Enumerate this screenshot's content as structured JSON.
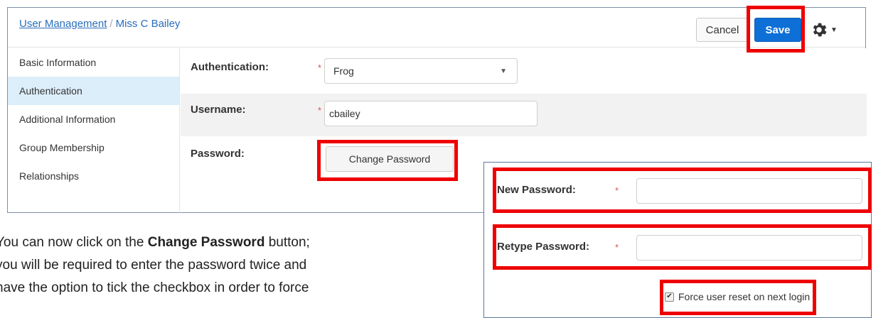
{
  "header": {
    "breadcrumb_root": "User Management",
    "breadcrumb_sep": "/",
    "breadcrumb_current": "Miss C Bailey",
    "cancel_label": "Cancel",
    "save_label": "Save",
    "settings_icon": "gear-icon"
  },
  "sidebar": {
    "items": [
      {
        "label": "Basic Information",
        "active": false
      },
      {
        "label": "Authentication",
        "active": true
      },
      {
        "label": "Additional Information",
        "active": false
      },
      {
        "label": "Group Membership",
        "active": false
      },
      {
        "label": "Relationships",
        "active": false
      }
    ]
  },
  "form": {
    "authentication": {
      "label": "Authentication:",
      "value": "Frog"
    },
    "username": {
      "label": "Username:",
      "value": "cbailey"
    },
    "password": {
      "label": "Password:",
      "button": "Change Password"
    },
    "required_mark": "*"
  },
  "popup": {
    "new_password_label": "New Password:",
    "retype_password_label": "Retype Password:",
    "force_reset_label": "Force user reset on next login",
    "force_reset_checked": true,
    "check_glyph": "✔"
  },
  "instructions": {
    "line1_pre": "You can now click on the ",
    "line1_bold": "Change Password",
    "line1_post": " button;",
    "line2": "you will be required to enter the password twice and",
    "line3": "have the option to tick the checkbox in order to force"
  },
  "colors": {
    "accent": "#0e6fd7",
    "highlight": "#ee0000",
    "active_nav": "#ddeefb"
  }
}
